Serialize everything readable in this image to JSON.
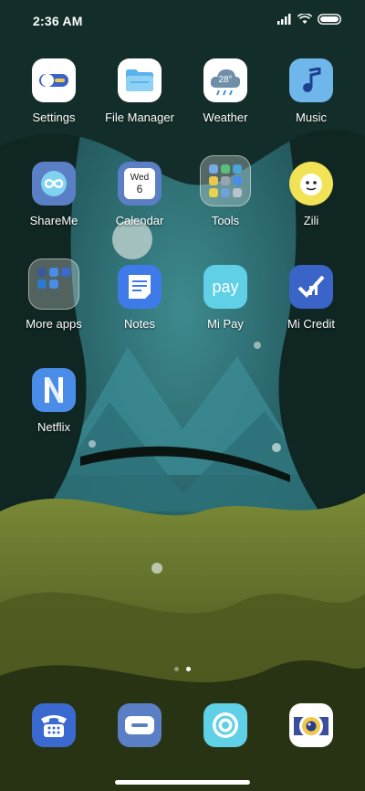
{
  "status_bar": {
    "time": "2:36 AM",
    "icons": [
      "signal-icon",
      "wifi-icon",
      "battery-icon"
    ]
  },
  "apps": [
    {
      "name": "settings",
      "label": "Settings",
      "icon": "settings-toggle-icon",
      "color": "#ffffff"
    },
    {
      "name": "file-manager",
      "label": "File Manager",
      "icon": "folder-icon",
      "color": "#ffffff"
    },
    {
      "name": "weather",
      "label": "Weather",
      "icon": "weather-cloud-icon",
      "color": "#ffffff",
      "badge": "28°"
    },
    {
      "name": "music",
      "label": "Music",
      "icon": "music-note-icon",
      "color": "#6fb7ea"
    },
    {
      "name": "shareme",
      "label": "ShareMe",
      "icon": "infinity-icon",
      "color": "#5a7fc5"
    },
    {
      "name": "calendar",
      "label": "Calendar",
      "icon": "calendar-icon",
      "color": "#5a7fc5",
      "day_name": "Wed",
      "day_num": "6"
    },
    {
      "name": "tools",
      "label": "Tools",
      "icon": "folder-tools-icon",
      "color": "#ffffff"
    },
    {
      "name": "zili",
      "label": "Zili",
      "icon": "zili-face-icon",
      "color": "#f2e356"
    },
    {
      "name": "more-apps",
      "label": "More apps",
      "icon": "folder-more-apps-icon",
      "color": "#ffffff"
    },
    {
      "name": "notes",
      "label": "Notes",
      "icon": "notes-icon",
      "color": "#3e7be8"
    },
    {
      "name": "mi-pay",
      "label": "Mi Pay",
      "icon": "mi-pay-icon",
      "color": "#5fd0e6",
      "badge": "pay"
    },
    {
      "name": "mi-credit",
      "label": "Mi Credit",
      "icon": "mi-credit-icon",
      "color": "#3a64c8"
    },
    {
      "name": "netflix",
      "label": "Netflix",
      "icon": "netflix-n-icon",
      "color": "#4a8de8"
    }
  ],
  "dock": [
    {
      "name": "phone",
      "icon": "phone-icon",
      "color": "#3a6ad0"
    },
    {
      "name": "messages",
      "icon": "message-icon",
      "color": "#5a7fc5"
    },
    {
      "name": "browser",
      "icon": "browser-icon",
      "color": "#5fd0e6"
    },
    {
      "name": "camera",
      "icon": "camera-icon",
      "color": "#ffffff"
    }
  ],
  "page_indicator": {
    "pages": 2,
    "current": 2
  }
}
